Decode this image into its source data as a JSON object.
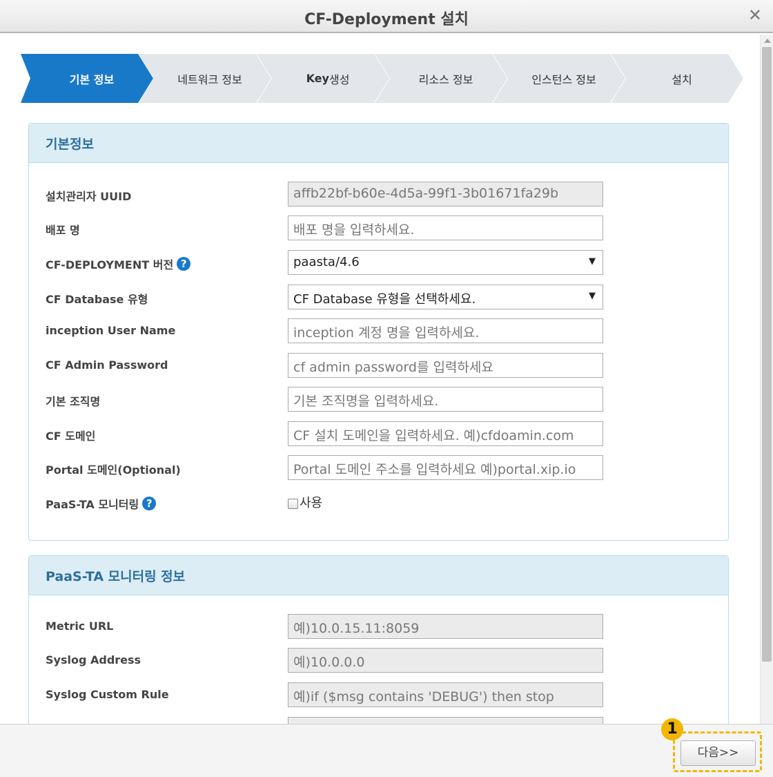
{
  "window": {
    "title": "CF-Deployment 설치",
    "close_label": "✕"
  },
  "steps": [
    {
      "label": "기본 정보",
      "active": true
    },
    {
      "label": "네트워크 정보"
    },
    {
      "label_bold": "Key",
      "label": " 생성"
    },
    {
      "label": "리소스 정보"
    },
    {
      "label": "인스턴스 정보"
    },
    {
      "label": "설치"
    }
  ],
  "basic": {
    "header": "기본정보",
    "uuid": {
      "label": "설치관리자 UUID",
      "value": "affb22bf-b60e-4d5a-99f1-3b01671fa29b"
    },
    "deploy_name": {
      "label": "배포 명",
      "placeholder": "배포 명을 입력하세요."
    },
    "cf_version": {
      "label": "CF-DEPLOYMENT 버전",
      "value": "paasta/4.6"
    },
    "db_type": {
      "label": "CF Database 유형",
      "value": "CF Database 유형을 선택하세요."
    },
    "inception_user": {
      "label": "inception User Name",
      "placeholder": "inception 계정 명을 입력하세요."
    },
    "admin_password": {
      "label": "CF Admin Password",
      "placeholder": "cf admin password를 입력하세요"
    },
    "org_name": {
      "label": "기본 조직명",
      "placeholder": "기본 조직명을 입력하세요."
    },
    "cf_domain": {
      "label": "CF 도메인",
      "placeholder": "CF 설치 도메인을 입력하세요. 예)cfdoamin.com"
    },
    "portal_domain": {
      "label": "Portal 도메인(Optional)",
      "placeholder": "Portal 도메인 주소를 입력하세요 예)portal.xip.io"
    },
    "monitoring": {
      "label": "PaaS-TA 모니터링",
      "checkbox_label": "사용"
    }
  },
  "monitoring_info": {
    "header": "PaaS-TA 모니터링 정보",
    "metric_url": {
      "label": "Metric URL",
      "placeholder": "예)10.0.15.11:8059"
    },
    "syslog_address": {
      "label": "Syslog Address",
      "placeholder": "예)10.0.0.0"
    },
    "syslog_rule": {
      "label": "Syslog Custom Rule",
      "placeholder": "예)if ($msg contains 'DEBUG') then stop"
    }
  },
  "footer": {
    "next_label": "다음>>",
    "badge_number": "1"
  },
  "colors": {
    "accent": "#1979c9",
    "panel_header": "#dcedf6",
    "highlight": "#f2b600"
  }
}
